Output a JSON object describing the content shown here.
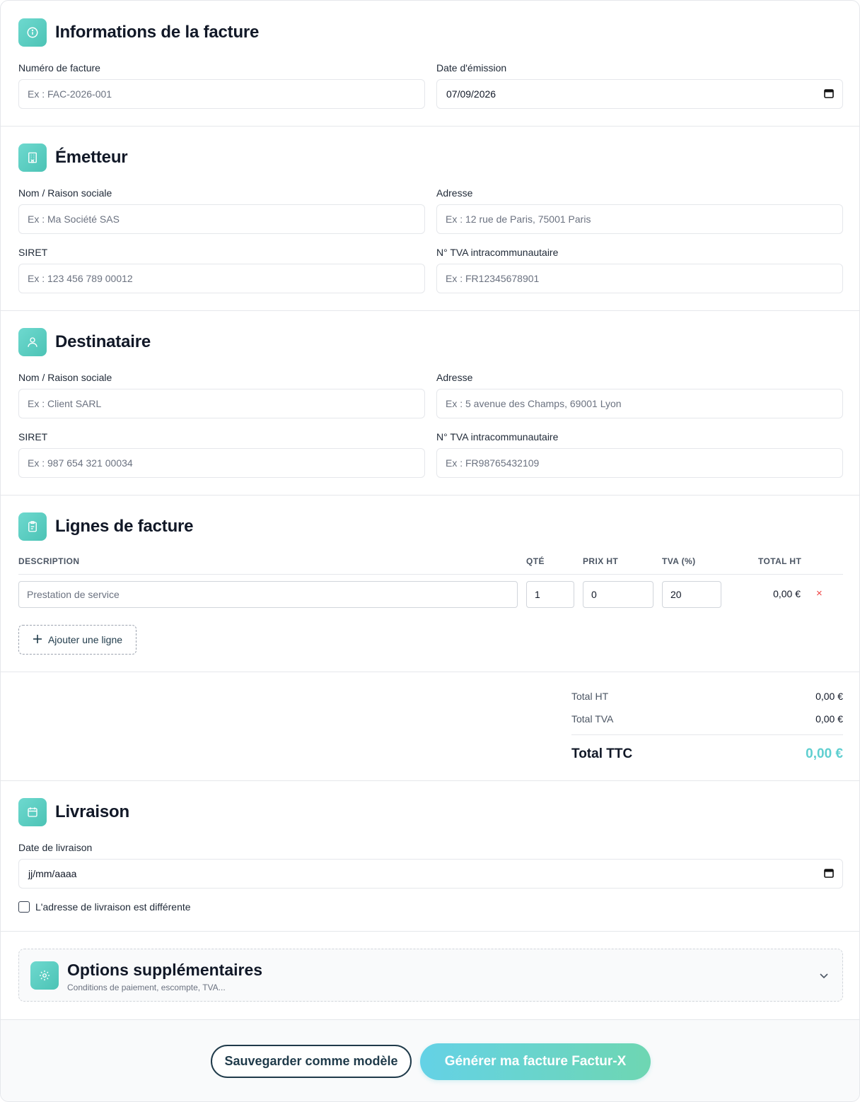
{
  "invoice": {
    "title": "Informations de la facture",
    "number_label": "Numéro de facture",
    "number_placeholder": "Ex : FAC-2026-001",
    "date_label": "Date d'émission",
    "date_value": "07/09/2026"
  },
  "issuer": {
    "title": "Émetteur",
    "name_label": "Nom / Raison sociale",
    "name_placeholder": "Ex : Ma Société SAS",
    "address_label": "Adresse",
    "address_placeholder": "Ex : 12 rue de Paris, 75001 Paris",
    "siret_label": "SIRET",
    "siret_placeholder": "Ex : 123 456 789 00012",
    "vat_label": "N° TVA intracommunautaire",
    "vat_placeholder": "Ex : FR12345678901"
  },
  "recipient": {
    "title": "Destinataire",
    "name_label": "Nom / Raison sociale",
    "name_placeholder": "Ex : Client SARL",
    "address_label": "Adresse",
    "address_placeholder": "Ex : 5 avenue des Champs, 69001 Lyon",
    "siret_label": "SIRET",
    "siret_placeholder": "Ex : 987 654 321 00034",
    "vat_label": "N° TVA intracommunautaire",
    "vat_placeholder": "Ex : FR98765432109"
  },
  "lines": {
    "title": "Lignes de facture",
    "columns": {
      "description": "DESCRIPTION",
      "qty": "QTÉ",
      "price": "PRIX HT",
      "vat": "TVA (%)",
      "total": "TOTAL HT"
    },
    "rows": [
      {
        "description_placeholder": "Prestation de service",
        "qty": "1",
        "price": "0",
        "vat": "20",
        "total": "0,00 €",
        "remove": "×"
      }
    ],
    "add_label": "Ajouter une ligne"
  },
  "totals": {
    "ht_label": "Total HT",
    "ht_value": "0,00 €",
    "tva_label": "Total TVA",
    "tva_value": "0,00 €",
    "ttc_label": "Total TTC",
    "ttc_value": "0,00 €"
  },
  "delivery": {
    "title": "Livraison",
    "date_label": "Date de livraison",
    "date_placeholder": "jj/mm/aaaa",
    "different_address_label": "L'adresse de livraison est différente",
    "different_address_checked": false
  },
  "options": {
    "title": "Options supplémentaires",
    "subtitle": "Conditions de paiement, escompte, TVA..."
  },
  "actions": {
    "save_template": "Sauvegarder comme modèle",
    "generate": "Générer ma facture Factur-X"
  },
  "colors": {
    "accent": "#4cc3b5",
    "ttc_accent": "#5fcfd0",
    "dark": "#1f3a4a",
    "remove": "#ef4444"
  }
}
